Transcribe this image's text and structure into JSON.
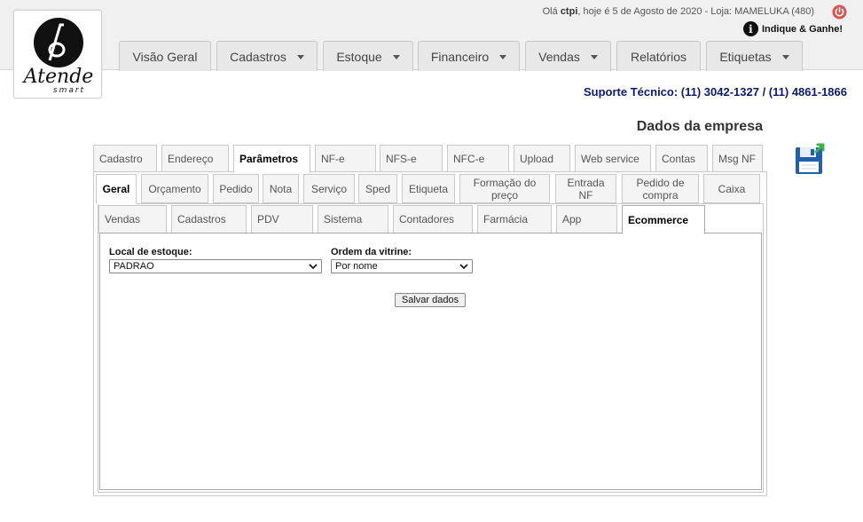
{
  "header": {
    "greeting_prefix": "Olá ",
    "user": "ctpi",
    "greeting_suffix": ", hoje é 5 de Agosto de 2020 - Loja: MAMELUKA (480)",
    "indique": "Indique & Ganhe!",
    "logo_text": "Atende",
    "logo_sub": "smart"
  },
  "nav": {
    "items": [
      {
        "label": "Visão Geral",
        "dropdown": false
      },
      {
        "label": "Cadastros",
        "dropdown": true
      },
      {
        "label": "Estoque",
        "dropdown": true
      },
      {
        "label": "Financeiro",
        "dropdown": true
      },
      {
        "label": "Vendas",
        "dropdown": true
      },
      {
        "label": "Relatórios",
        "dropdown": false
      },
      {
        "label": "Etiquetas",
        "dropdown": true
      }
    ]
  },
  "suporte": "Suporte Técnico: (11) 3042-1327 / (11) 4861-1866",
  "page_title": "Dados da empresa",
  "tabs_row1": [
    "Cadastro",
    "Endereço",
    "Parâmetros",
    "NF-e",
    "NFS-e",
    "NFC-e",
    "Upload",
    "Web service",
    "Contas",
    "Msg NF"
  ],
  "tabs_row2": [
    "Geral",
    "Orçamento",
    "Pedido",
    "Nota",
    "Serviço",
    "Sped",
    "Etiqueta",
    "Formação do preço",
    "Entrada NF",
    "Pedido de compra",
    "Caixa"
  ],
  "tabs_row3": [
    "Vendas",
    "Cadastros",
    "PDV",
    "Sistema",
    "Contadores",
    "Farmácia",
    "App",
    "Ecommerce"
  ],
  "active": {
    "row1": "Parâmetros",
    "row2": "Geral",
    "row3": "Ecommerce"
  },
  "form": {
    "local_estoque_label": "Local de estoque:",
    "local_estoque_value": "PADRAO",
    "ordem_vitrine_label": "Ordem da vitrine:",
    "ordem_vitrine_value": "Por nome",
    "save_button": "Salvar dados"
  },
  "colors": {
    "support_text": "#0b1a6e",
    "power_icon": "#d9534f",
    "save_icon_blue": "#1f5fae",
    "save_icon_arrow": "#39b54a"
  },
  "icons": [
    "power-icon",
    "info-icon",
    "save-disk-icon",
    "chevron-down-icon"
  ]
}
